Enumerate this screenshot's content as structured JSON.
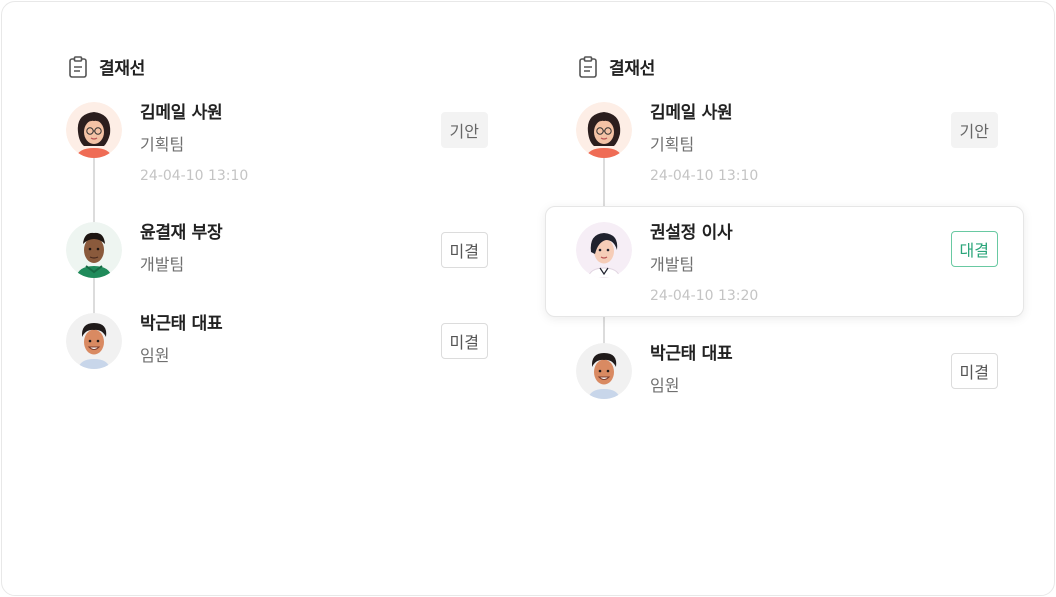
{
  "panels": [
    {
      "title": "결재선",
      "approvers": [
        {
          "name": "김메일 사원",
          "dept": "기획팀",
          "time": "24-04-10 13:10",
          "status": "기안",
          "avatar": "woman-glasses-avatar"
        },
        {
          "name": "윤결재 부장",
          "dept": "개발팀",
          "time": "",
          "status": "미결",
          "avatar": "man-dark-skin-avatar"
        },
        {
          "name": "박근태 대표",
          "dept": "임원",
          "time": "",
          "status": "미결",
          "avatar": "man-smiling-avatar"
        }
      ]
    },
    {
      "title": "결재선",
      "approvers": [
        {
          "name": "김메일 사원",
          "dept": "기획팀",
          "time": "24-04-10 13:10",
          "status": "기안",
          "avatar": "woman-glasses-avatar"
        },
        {
          "name": "권설정 이사",
          "dept": "개발팀",
          "time": "24-04-10 13:20",
          "status": "대결",
          "avatar": "woman-short-hair-avatar"
        },
        {
          "name": "박근태 대표",
          "dept": "임원",
          "time": "",
          "status": "미결",
          "avatar": "man-smiling-avatar"
        }
      ]
    }
  ],
  "colors": {
    "proxy_approval_green": "#2aa57a",
    "timeline_line": "#dcdcdc",
    "timestamp_gray": "#c4c4c4"
  }
}
